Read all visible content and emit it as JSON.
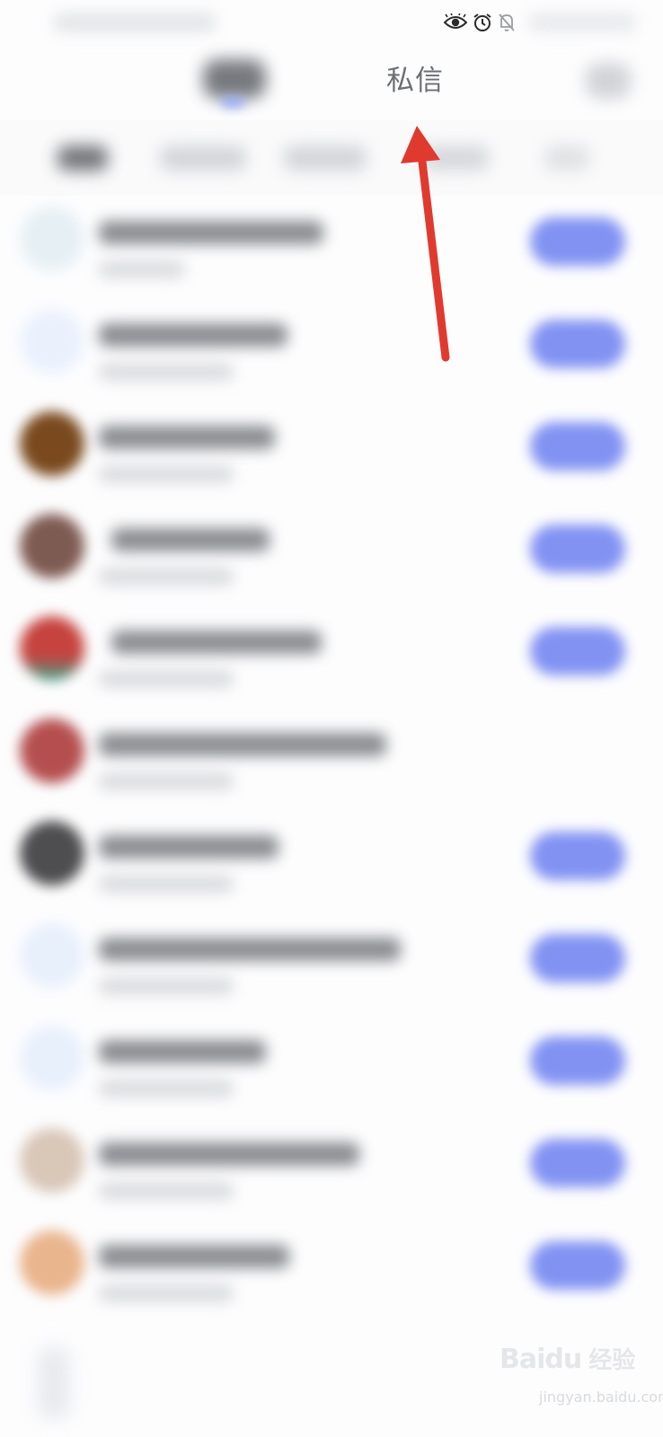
{
  "status_bar": {
    "icons": [
      "eye-icon",
      "alarm-clock-icon",
      "bell-muted-icon"
    ]
  },
  "nav": {
    "title": "私信"
  },
  "annotation": {
    "arrow_color": "#e03a2f"
  },
  "colors": {
    "accent": "#7b8df2",
    "title_text": "#6b6e73"
  },
  "list": {
    "rows": [
      {
        "avatar_color": "#e6f0f4",
        "has_action": true
      },
      {
        "avatar_color": "#eaf1fd",
        "has_action": true
      },
      {
        "avatar_color": "#7a4a1e",
        "has_action": true
      },
      {
        "avatar_color": "#7e5b52",
        "has_action": true
      },
      {
        "avatar_color": "#c6433e",
        "has_action": true
      },
      {
        "avatar_color": "#b54f4f",
        "has_action": false
      },
      {
        "avatar_color": "#4e4e50",
        "has_action": true
      },
      {
        "avatar_color": "#e8f0fc",
        "has_action": true
      },
      {
        "avatar_color": "#e8f0fc",
        "has_action": true
      },
      {
        "avatar_color": "#d9c7b8",
        "has_action": true
      },
      {
        "avatar_color": "#e9b58c",
        "has_action": true
      }
    ]
  },
  "watermark": {
    "logo": "Baidu",
    "text": "经验",
    "url": "jingyan.baidu.com"
  }
}
